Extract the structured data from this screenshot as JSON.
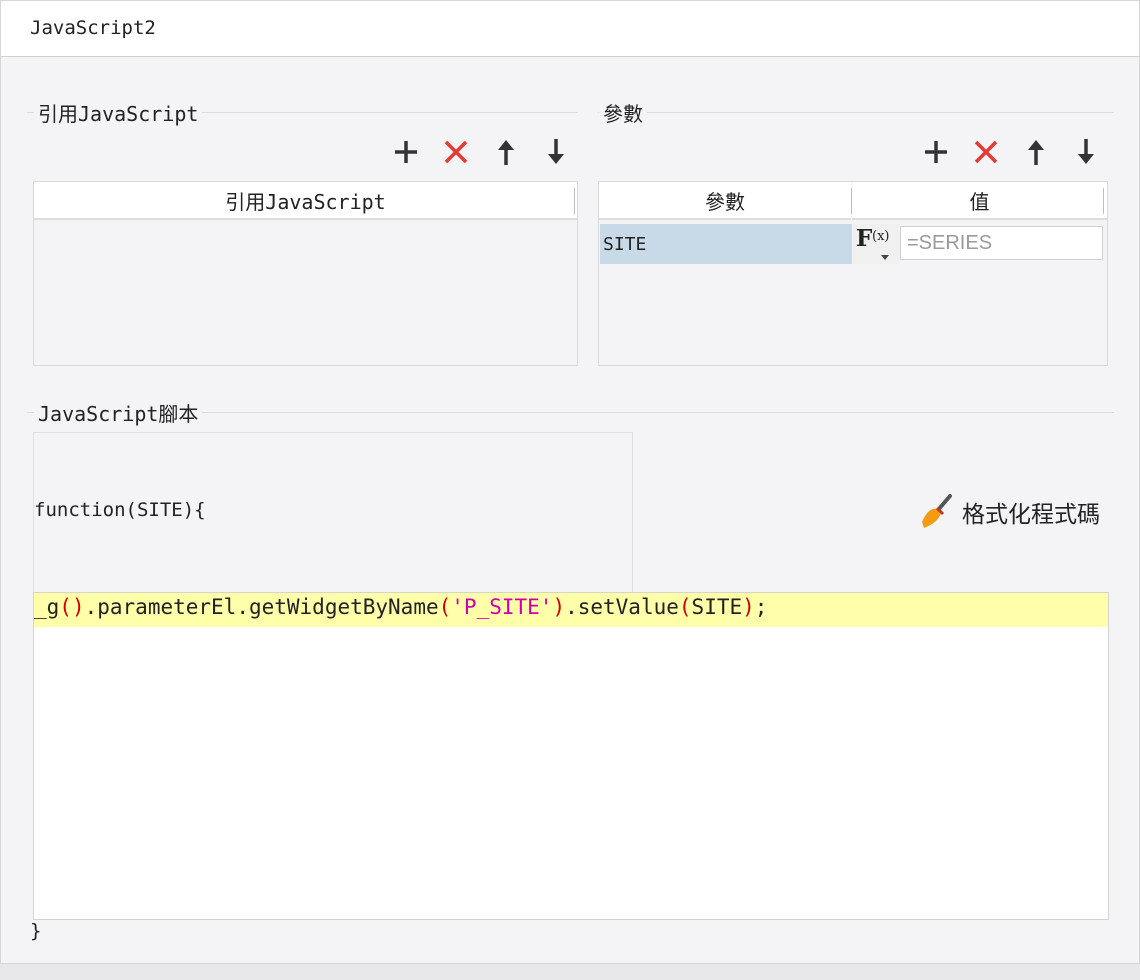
{
  "tab": {
    "title": "JavaScript2"
  },
  "imports": {
    "group_label": "引用JavaScript",
    "column_header": "引用JavaScript",
    "toolbar": [
      "add-icon",
      "delete-icon",
      "arrow-up-icon",
      "arrow-down-icon"
    ]
  },
  "params": {
    "group_label": "參數",
    "columns": {
      "name": "參數",
      "value": "值"
    },
    "toolbar": [
      "add-icon",
      "delete-icon",
      "arrow-up-icon",
      "arrow-down-icon"
    ],
    "rows": [
      {
        "name": "SITE",
        "value_placeholder": "=SERIES",
        "formula_button": "F(x)"
      }
    ]
  },
  "script": {
    "group_label": "JavaScript腳本",
    "header": "function(SITE){",
    "line_prefix": "_g",
    "line_open": "(",
    "line_close": ")",
    "line_mid1": ".parameterEl.getWidgetByName",
    "line_str": "'P_SITE'",
    "line_mid2": ".setValue",
    "line_arg": "SITE",
    "line_end": ";",
    "footer": "}",
    "format_label": "格式化程式碼",
    "format_icon": "broom-icon"
  },
  "colors": {
    "add": "#333333",
    "delete": "#e53935",
    "highlight_line": "#ffffaa",
    "selected_row": "#c8dae8",
    "string": "#cc00aa",
    "paren": "#d00000"
  }
}
